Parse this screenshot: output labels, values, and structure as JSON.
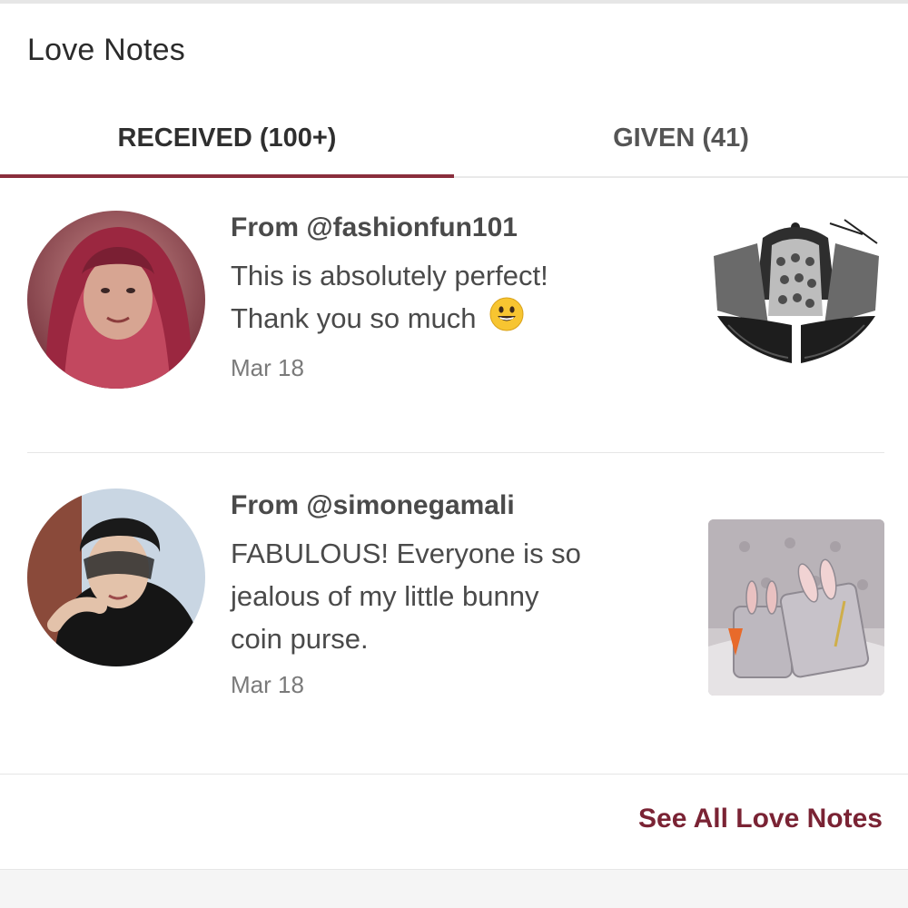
{
  "section": {
    "title": "Love Notes"
  },
  "tabs": [
    {
      "label": "RECEIVED (100+)",
      "active": true
    },
    {
      "label": "GIVEN (41)",
      "active": false
    }
  ],
  "notes": [
    {
      "from": "From @fashionfun101",
      "text_line1": "This is absolutely perfect!",
      "text_line2": "Thank you so much",
      "emoji": "grinning-face-icon",
      "date": "Mar 18",
      "avatar": "avatar-woman-red-hair",
      "product": "black-lace-bra-image"
    },
    {
      "from": "From @simonegamali",
      "text_line1": "FABULOUS! Everyone is so",
      "text_line2": "jealous of my little bunny",
      "text_line3": "coin purse.",
      "date": "Mar 18",
      "avatar": "avatar-woman-lace-mask",
      "product": "bunny-coin-purse-image"
    }
  ],
  "footer": {
    "link_label": "See All Love Notes"
  },
  "colors": {
    "accent": "#8a2e3c",
    "link": "#7a2334"
  }
}
